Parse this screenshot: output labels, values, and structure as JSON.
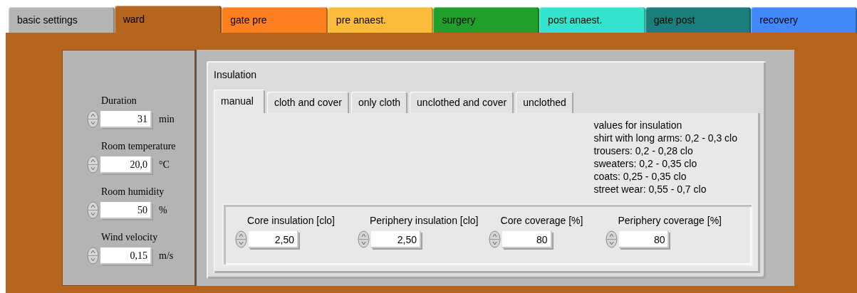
{
  "tabs": [
    {
      "label": "basic settings",
      "color": "#b4b4b4",
      "selected": false
    },
    {
      "label": "ward",
      "color": "#b5651d",
      "selected": true
    },
    {
      "label": "gate pre",
      "color": "#fe7f1d",
      "selected": false
    },
    {
      "label": "pre anaest.",
      "color": "#fdbb3b",
      "selected": false
    },
    {
      "label": "surgery",
      "color": "#1fa02a",
      "selected": false
    },
    {
      "label": "post anaest.",
      "color": "#33e4cc",
      "selected": false
    },
    {
      "label": "gate post",
      "color": "#1a7f7a",
      "selected": false
    },
    {
      "label": "recovery",
      "color": "#4188fa",
      "selected": false
    }
  ],
  "room_parameters": [
    {
      "label": "Duration",
      "value": "31",
      "unit": "min"
    },
    {
      "label": "Room temperature",
      "value": "20,0",
      "unit": "°C"
    },
    {
      "label": "Room humidity",
      "value": "50",
      "unit": "%"
    },
    {
      "label": "Wind velocity",
      "value": "0,15",
      "unit": "m/s"
    }
  ],
  "insulation": {
    "title": "Insulation",
    "tabs": [
      {
        "label": "manual",
        "selected": true
      },
      {
        "label": "cloth and cover",
        "selected": false
      },
      {
        "label": "only cloth",
        "selected": false
      },
      {
        "label": "unclothed and cover",
        "selected": false
      },
      {
        "label": "unclothed",
        "selected": false
      }
    ],
    "notes": [
      "values for insulation",
      "shirt with long arms: 0,2 - 0,3 clo",
      "trousers: 0,2 - 0,28 clo",
      "sweaters: 0,2 - 0,35 clo",
      "coats: 0,25 - 0,35 clo",
      "street wear: 0,55 - 0,7 clo"
    ],
    "fields": [
      {
        "label": "Core insulation [clo]",
        "value": "2,50"
      },
      {
        "label": "Periphery insulation [clo]",
        "value": "2,50"
      },
      {
        "label": "Core coverage [%]",
        "value": "80"
      },
      {
        "label": "Periphery coverage [%]",
        "value": "80"
      }
    ]
  }
}
